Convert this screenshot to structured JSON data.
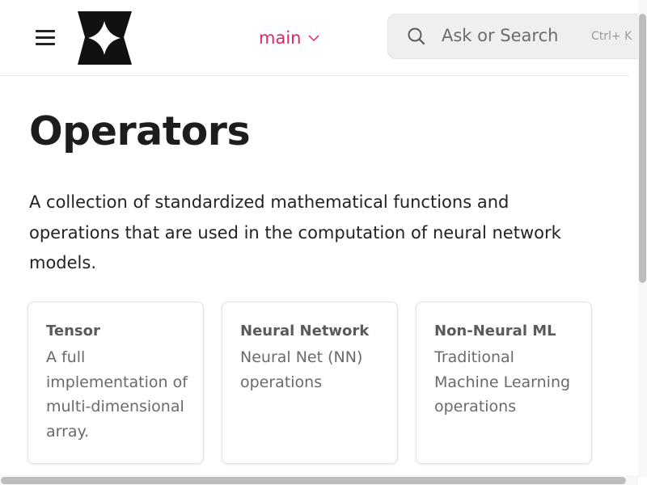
{
  "header": {
    "menu_icon": "hamburger-icon",
    "logo_icon": "star-logo-icon",
    "version": {
      "label": "main",
      "icon": "chevron-down-icon"
    },
    "search": {
      "placeholder": "Ask or Search",
      "shortcut": "Ctrl+ K",
      "icon": "search-icon"
    }
  },
  "main": {
    "title": "Operators",
    "intro": "A collection of standardized mathematical functions and operations that are used in the computation of neural network models.",
    "cards": [
      {
        "title": "Tensor",
        "description": "A full implementation of multi-dimensional array."
      },
      {
        "title": "Neural Network",
        "description": "Neural Net (NN) operations"
      },
      {
        "title": "Non-Neural ML",
        "description": "Traditional Machine Learning operations"
      }
    ]
  },
  "colors": {
    "accent": "#e0265e",
    "text": "#1d1d1d",
    "search_bg": "#efefef"
  }
}
